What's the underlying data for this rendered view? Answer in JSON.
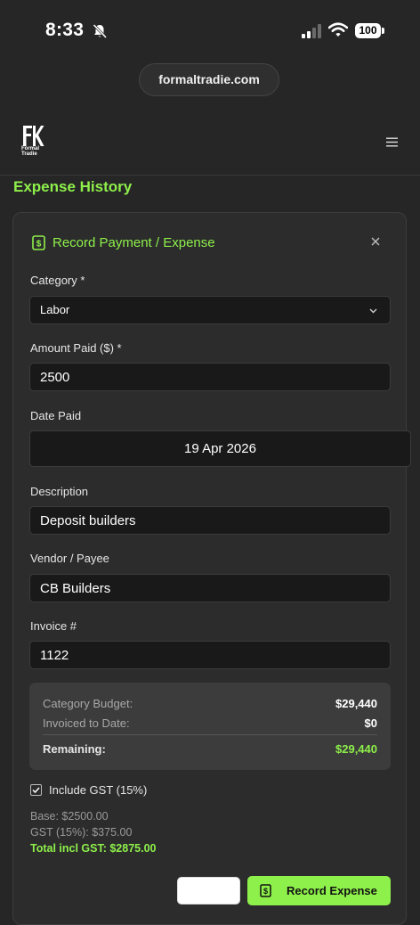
{
  "status": {
    "time": "8:33",
    "battery": "100"
  },
  "browser": {
    "url": "formaltradie.com"
  },
  "header": {
    "logo_line1": "Formal",
    "logo_line2": "Tradie"
  },
  "page": {
    "title": "Expense History"
  },
  "form": {
    "title": "Record Payment / Expense",
    "category_label": "Category *",
    "category_value": "Labor",
    "amount_label": "Amount Paid ($) *",
    "amount_value": "2500",
    "date_label": "Date Paid",
    "date_value": "19 Apr 2026",
    "description_label": "Description",
    "description_value": "Deposit builders",
    "vendor_label": "Vendor / Payee",
    "vendor_value": "CB Builders",
    "invoice_label": "Invoice #",
    "invoice_value": "1122"
  },
  "budget": {
    "category_budget_label": "Category Budget:",
    "category_budget_value": "$29,440",
    "invoiced_label": "Invoiced to Date:",
    "invoiced_value": "$0",
    "remaining_label": "Remaining:",
    "remaining_value": "$29,440"
  },
  "gst": {
    "include_label": "Include GST (15%)",
    "checked": true,
    "base_line": "Base: $2500.00",
    "gst_line": "GST (15%): $375.00",
    "total_line": "Total incl GST: $2875.00"
  },
  "actions": {
    "cancel_label": "",
    "record_label": "Record Expense"
  },
  "colors": {
    "accent": "#8ef04a",
    "background": "#262626",
    "card": "#2c2c2c",
    "field": "#191919"
  },
  "icons": [
    "bell-slash-icon",
    "signal-icon",
    "wifi-icon",
    "battery-icon",
    "logo-icon",
    "menu-icon",
    "dollar-bill-icon",
    "close-icon",
    "chevron-down-icon",
    "check-icon"
  ]
}
